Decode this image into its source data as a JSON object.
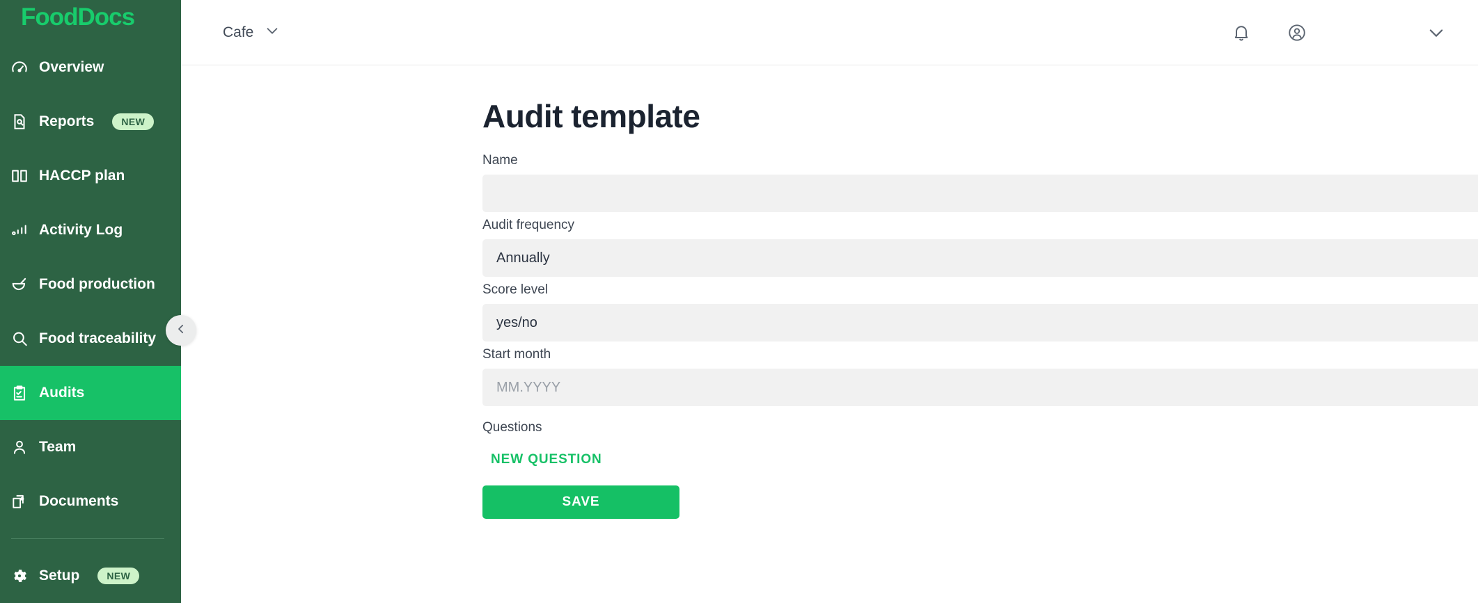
{
  "brand": {
    "logo_text": "FoodDocs",
    "logo_color": "#18cc6c",
    "sidebar_bg": "#2d6344",
    "active_color": "#17c167"
  },
  "sidebar": {
    "items": [
      {
        "label": "Overview",
        "icon": "gauge-icon",
        "badge": null,
        "active": false
      },
      {
        "label": "Reports",
        "icon": "report-icon",
        "badge": "NEW",
        "active": false
      },
      {
        "label": "HACCP plan",
        "icon": "book-icon",
        "badge": null,
        "active": false
      },
      {
        "label": "Activity Log",
        "icon": "bars-icon",
        "badge": null,
        "active": false
      },
      {
        "label": "Food production",
        "icon": "mortar-icon",
        "badge": null,
        "active": false
      },
      {
        "label": "Food traceability",
        "icon": "search-icon",
        "badge": null,
        "active": false
      },
      {
        "label": "Audits",
        "icon": "clipboard-icon",
        "badge": null,
        "active": true
      },
      {
        "label": "Team",
        "icon": "person-icon",
        "badge": null,
        "active": false
      },
      {
        "label": "Documents",
        "icon": "documents-icon",
        "badge": null,
        "active": false
      }
    ],
    "footer_items": [
      {
        "label": "Setup",
        "icon": "gear-icon",
        "badge": "NEW",
        "active": false
      }
    ],
    "collapse_icon": "chevron-left-icon"
  },
  "topbar": {
    "site": "Cafe",
    "site_chevron": "chevron-down-icon",
    "notifications_icon": "bell-icon",
    "account_icon": "user-circle-icon",
    "menu_chevron": "chevron-down-icon"
  },
  "page": {
    "title": "Audit template",
    "fields": {
      "name": {
        "label": "Name",
        "value": "",
        "placeholder": ""
      },
      "audit_frequency": {
        "label": "Audit frequency",
        "value": "Annually"
      },
      "score_level": {
        "label": "Score level",
        "value": "yes/no"
      },
      "start_month": {
        "label": "Start month",
        "value": "",
        "placeholder": "MM.YYYY",
        "icon": "calendar-icon"
      }
    },
    "questions_label": "Questions",
    "new_question_label": "NEW QUESTION",
    "save_label": "SAVE"
  }
}
